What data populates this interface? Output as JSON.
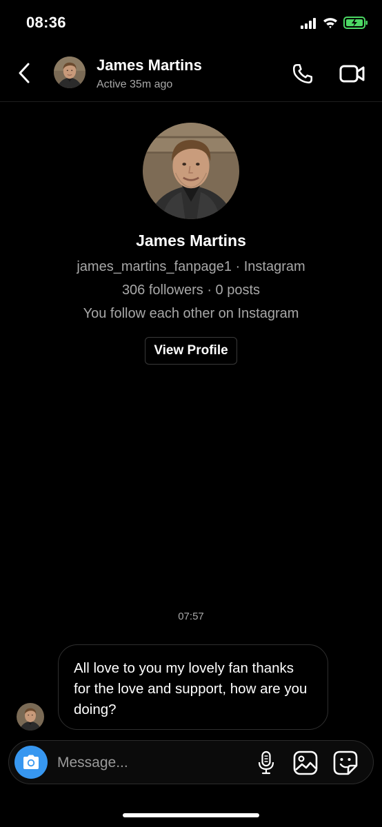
{
  "status_bar": {
    "time": "08:36"
  },
  "header": {
    "name": "James Martins",
    "status": "Active 35m ago"
  },
  "profile": {
    "name": "James Martins",
    "handle_line": "james_martins_fanpage1 · Instagram",
    "stats_line": "306 followers · 0 posts",
    "relation_line": "You follow each other on Instagram",
    "view_profile_label": "View Profile"
  },
  "conversation": {
    "timestamp": "07:57",
    "messages": [
      {
        "text": "All love to you my lovely fan thanks for the love and support, how are you doing?"
      }
    ]
  },
  "composer": {
    "placeholder": "Message..."
  },
  "colors": {
    "background": "#000000",
    "accent": "#3797f0",
    "secondary_text": "#a8a8a8",
    "battery_charge": "#4cd964"
  },
  "icons": [
    "back-chevron-icon",
    "phone-icon",
    "video-camera-icon",
    "camera-icon",
    "microphone-icon",
    "gallery-icon",
    "sticker-icon",
    "signal-icon",
    "wifi-icon",
    "battery-icon"
  ]
}
